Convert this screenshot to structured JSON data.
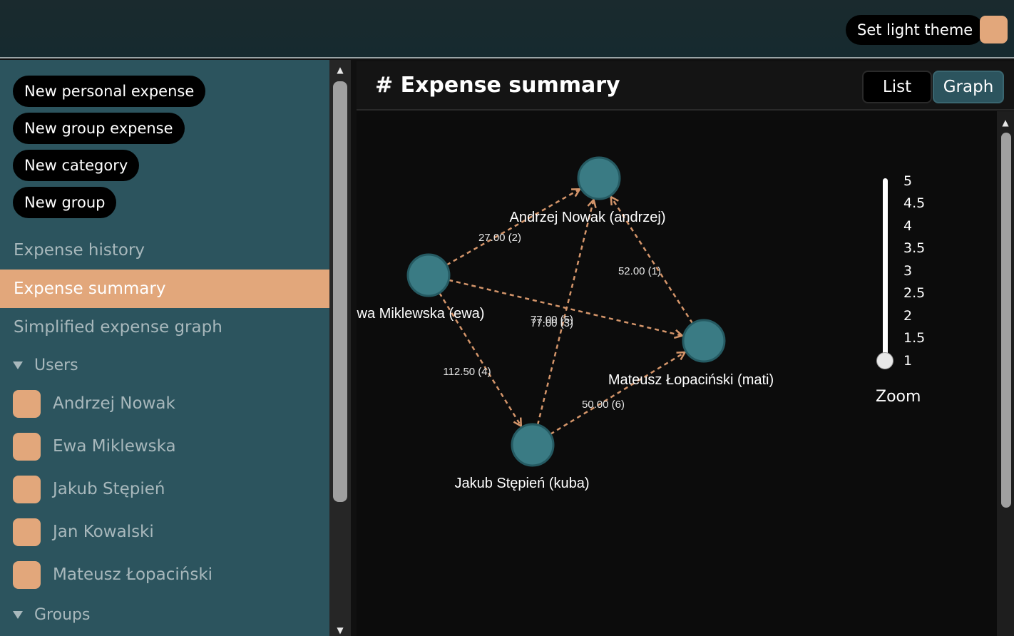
{
  "colors": {
    "accent": "#e2a77b",
    "sidebar_bg": "#2c545e",
    "node": "#3a7b84",
    "edge": "#d4956a"
  },
  "header": {
    "theme_button": "Set light theme"
  },
  "sidebar": {
    "actions": [
      "New personal expense",
      "New group expense",
      "New category",
      "New group"
    ],
    "nav": [
      {
        "label": "Expense history",
        "active": false
      },
      {
        "label": "Expense summary",
        "active": true
      },
      {
        "label": "Simplified expense graph",
        "active": false
      }
    ],
    "users_label": "Users",
    "users": [
      "Andrzej Nowak",
      "Ewa Miklewska",
      "Jakub Stępień",
      "Jan Kowalski",
      "Mateusz Łopaciński"
    ],
    "groups_label": "Groups"
  },
  "main": {
    "title": "# Expense summary",
    "tabs": [
      {
        "label": "List",
        "active": false
      },
      {
        "label": "Graph",
        "active": true
      }
    ],
    "zoom": {
      "label": "Zoom",
      "ticks": [
        "5",
        "4.5",
        "4",
        "3.5",
        "3",
        "2.5",
        "2",
        "1.5",
        "1"
      ],
      "value": 1
    }
  },
  "graph": {
    "nodes": [
      {
        "id": "andrzej",
        "label": "Andrzej Nowak (andrzej)"
      },
      {
        "id": "ewa",
        "label": "wa Miklewska (ewa)"
      },
      {
        "id": "mati",
        "label": "Mateusz Łopaciński (mati)"
      },
      {
        "id": "kuba",
        "label": "Jakub Stępień (kuba)"
      }
    ],
    "edges": [
      {
        "from": "ewa",
        "to": "andrzej",
        "label": "27.00 (2)"
      },
      {
        "from": "mati",
        "to": "andrzej",
        "label": "52.00 (1)"
      },
      {
        "from": "ewa",
        "to": "mati",
        "label": "77.00 (5)"
      },
      {
        "from": "kuba",
        "to": "andrzej",
        "label": "77.00 (3)"
      },
      {
        "from": "ewa",
        "to": "kuba",
        "label": "112.50 (4)"
      },
      {
        "from": "kuba",
        "to": "mati",
        "label": "50.00 (6)"
      }
    ]
  }
}
